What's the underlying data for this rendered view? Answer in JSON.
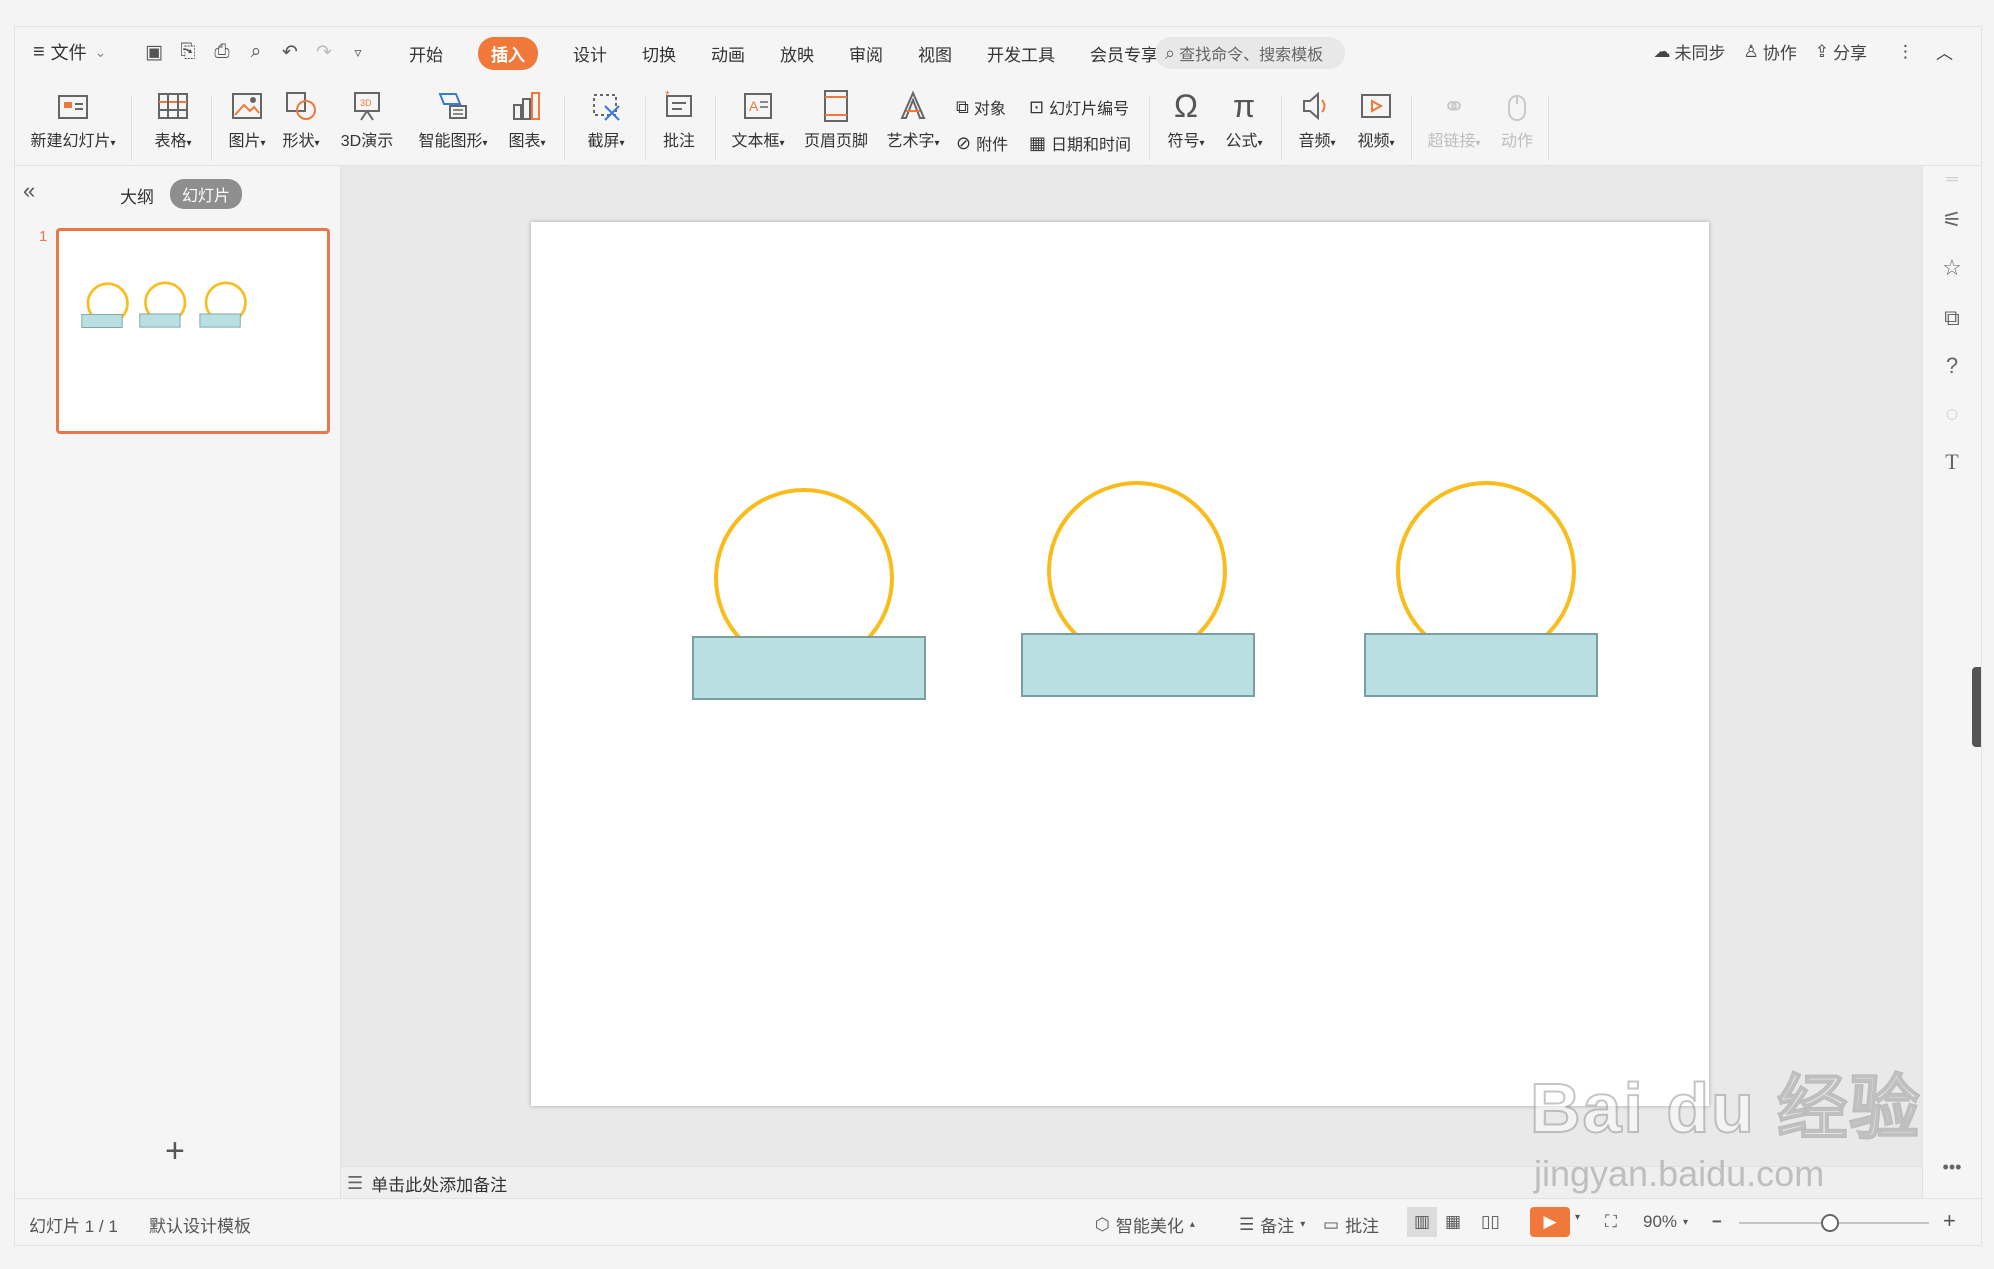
{
  "menu": {
    "file_label": "文件",
    "tabs": [
      "开始",
      "插入",
      "设计",
      "切换",
      "动画",
      "放映",
      "审阅",
      "视图",
      "开发工具",
      "会员专享"
    ],
    "active_tab": "插入",
    "search_placeholder": "查找命令、搜索模板",
    "sync_label": "未同步",
    "collab_label": "协作",
    "share_label": "分享"
  },
  "ribbon": {
    "new_slide": "新建幻灯片",
    "table": "表格",
    "picture": "图片",
    "shape": "形状",
    "three_d": "3D演示",
    "smart_art": "智能图形",
    "chart": "图表",
    "screenshot": "截屏",
    "comment": "批注",
    "textbox": "文本框",
    "header_footer": "页眉页脚",
    "art_text": "艺术字",
    "object": "对象",
    "attachment": "附件",
    "slide_number": "幻灯片编号",
    "date_time": "日期和时间",
    "symbol": "符号",
    "formula": "公式",
    "audio": "音频",
    "video": "视频",
    "hyperlink": "超链接",
    "action": "动作"
  },
  "left_panel": {
    "outline_tab": "大纲",
    "slides_tab": "幻灯片",
    "slide_index": "1",
    "add_icon": "+"
  },
  "notes": {
    "placeholder": "单击此处添加备注"
  },
  "status": {
    "slide_counter": "幻灯片 1 / 1",
    "template": "默认设计模板",
    "beautify": "智能美化",
    "notes": "备注",
    "comments": "批注",
    "zoom": "90%"
  },
  "watermark": {
    "brand": "Bai du 经验",
    "url": "jingyan.baidu.com"
  },
  "colors": {
    "accent": "#f0783a",
    "circle_stroke": "#f9bc1a",
    "rect_fill": "#b9dfe2",
    "rect_stroke": "#7a9fa3"
  }
}
